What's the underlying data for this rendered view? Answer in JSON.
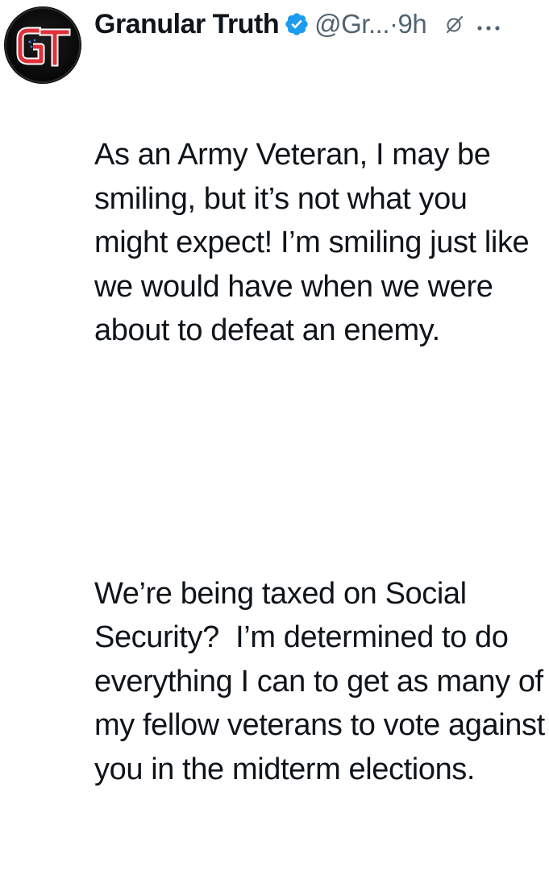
{
  "tweet": {
    "avatar_text": "GT",
    "display_name": "Granular Truth",
    "handle": "@Gr...",
    "separator": "·",
    "time": "9h",
    "paragraphs": [
      "As an Army Veteran, I may be smiling, but it’s not what you might expect! I’m smiling just like we would have when we were about to defeat an enemy.",
      "We’re being taxed on Social Security?  I’m determined to do everything I can to get as many of my fellow veterans to vote against you in the midterm elections."
    ]
  },
  "icons": {
    "verified": "verified-badge-icon",
    "grok": "grok-icon",
    "more": "more-options-icon"
  },
  "colors": {
    "text": "#0f1419",
    "secondary": "#536471",
    "verified": "#1d9bf0",
    "avatar_red": "#e0303a"
  }
}
